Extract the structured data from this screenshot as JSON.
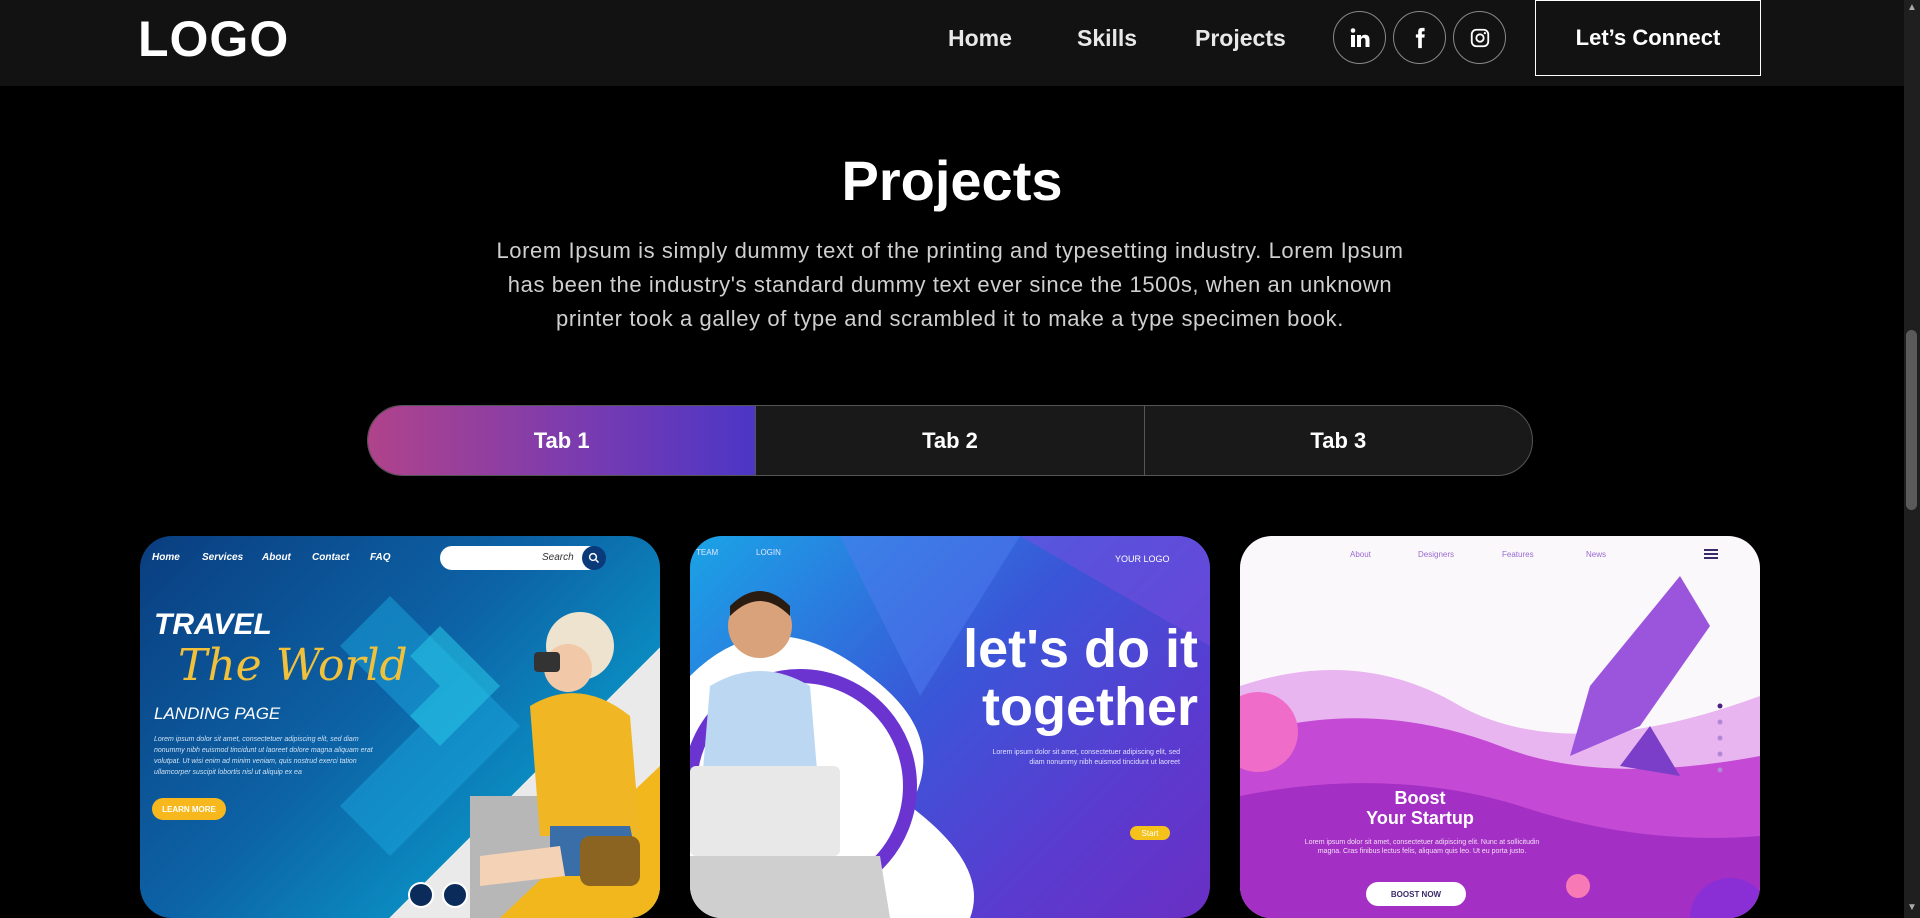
{
  "header": {
    "logo": "LOGO",
    "nav": [
      "Home",
      "Skills",
      "Projects"
    ],
    "social": [
      "linkedin-icon",
      "facebook-icon",
      "instagram-icon"
    ],
    "connect_label": "Let’s Connect"
  },
  "projects": {
    "title": "Projects",
    "description": "Lorem Ipsum is simply dummy text of the printing and typesetting industry. Lorem Ipsum has been the industry's standard dummy text ever since the 1500s, when an unknown printer took a galley of type and scrambled it to make a type specimen book.",
    "tabs": [
      "Tab 1",
      "Tab 2",
      "Tab 3"
    ],
    "active_tab": 0
  },
  "cards": {
    "travel": {
      "nav": [
        "Home",
        "Services",
        "About",
        "Contact",
        "FAQ"
      ],
      "search": "Search",
      "line1": "TRAVEL",
      "line2": "The World",
      "line3": "LANDING PAGE",
      "body": "Lorem ipsum dolor sit amet, consectetuer adipiscing elit, sed diam nonummy nibh euismod tincidunt ut laoreet dolore magna aliquam erat volutpat. Ut wisi enim ad minim veniam, quis nostrud exerci tation ullamcorper suscipit lobortis nisl ut aliquip ex ea",
      "button": "LEARN MORE"
    },
    "together": {
      "links": [
        "TEAM",
        "LOGIN"
      ],
      "logo": "YOUR LOGO",
      "headline": "let's do it together",
      "body": "Lorem ipsum dolor sit amet, consectetuer adipiscing elit, sed diam nonummy nibh euismod tincidunt ut laoreet",
      "button": "Start"
    },
    "startup": {
      "links": [
        "About",
        "Designers",
        "Features",
        "News"
      ],
      "line1": "Boost",
      "line2": "Your Startup",
      "body": "Lorem ipsum dolor sit amet, consectetuer adipiscing elit. Nunc at sollicitudin magna. Cras finibus lectus felis, aliquam quis leo. Ut eu porta justo.",
      "button": "BOOST NOW"
    }
  },
  "colors": {
    "tab_gradient_start": "#b0438b",
    "tab_gradient_end": "#4c36c6",
    "nav_bg": "#121212"
  }
}
